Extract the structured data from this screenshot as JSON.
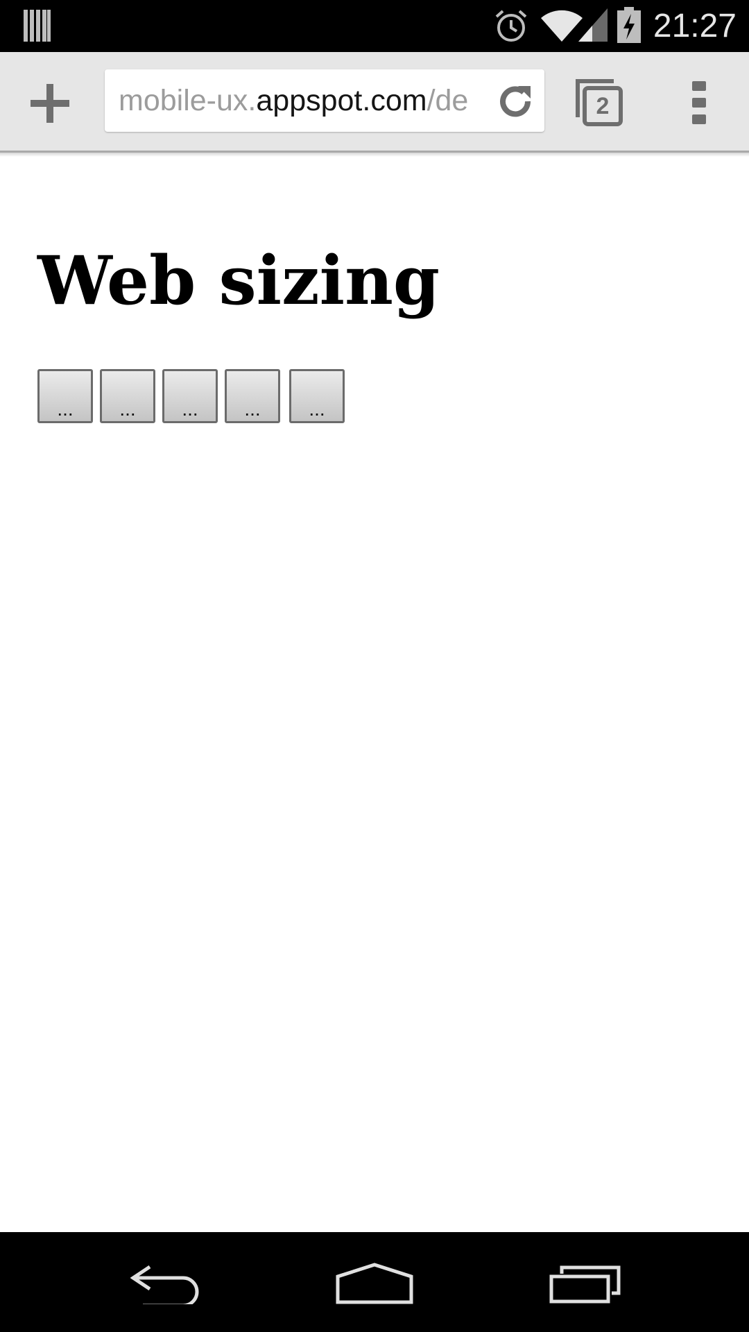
{
  "status_bar": {
    "time": "21:27",
    "icons": [
      "notification-bars-icon",
      "alarm-icon",
      "wifi-icon",
      "signal-icon",
      "battery-charging-icon"
    ]
  },
  "toolbar": {
    "new_tab_icon": "plus-icon",
    "url_prefix": "mobile-ux.",
    "url_domain": "appspot.com",
    "url_suffix": "/de",
    "reload_icon": "reload-icon",
    "tab_count": "2",
    "menu_icon": "overflow-menu-icon"
  },
  "page": {
    "title": "Web sizing",
    "buttons": [
      "...",
      "...",
      "...",
      "...",
      "..."
    ]
  },
  "nav_bar": {
    "icons": [
      "back-icon",
      "home-icon",
      "recent-apps-icon"
    ]
  },
  "colors": {
    "status_bar_bg": "#000000",
    "toolbar_bg": "#e6e6e6",
    "icon_gray": "#6e6e6e",
    "button_border": "#6b6b6b"
  }
}
